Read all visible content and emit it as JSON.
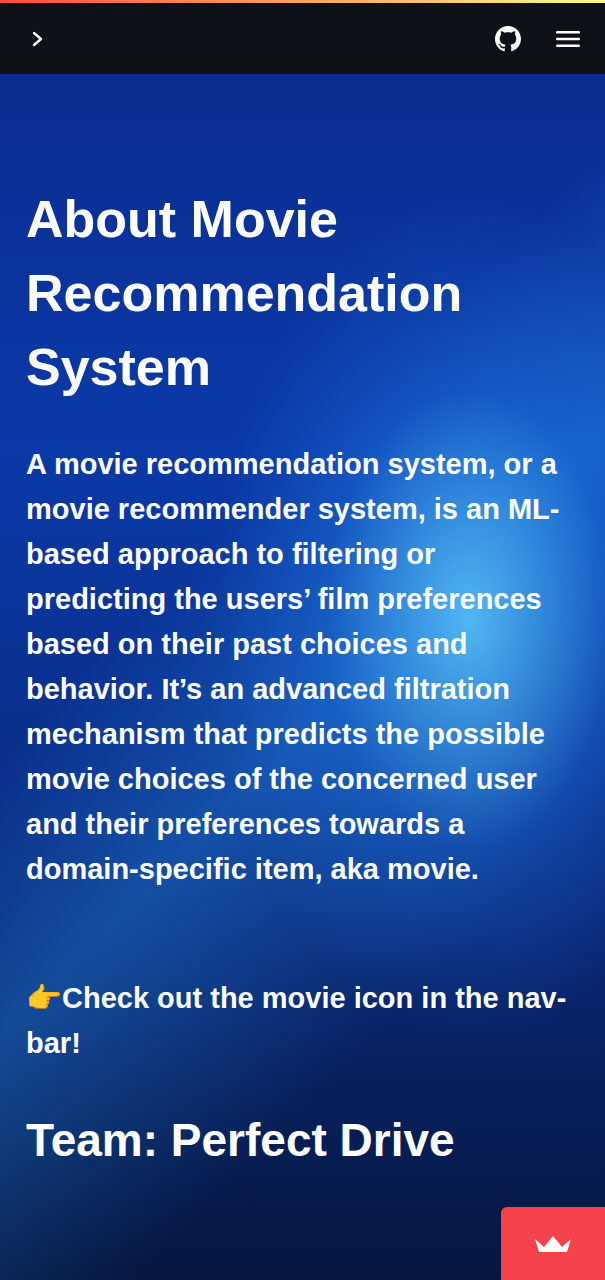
{
  "page": {
    "title": "About Movie Recommendation System",
    "description": "A movie recommendation system, or a movie recommender system, is an ML-based approach to filtering or predicting the users’ film preferences based on their past choices and behavior. It’s an advanced filtration mechanism that predicts the possible movie choices of the concerned user and their preferences towards a domain-specific item, aka movie.",
    "hint": {
      "emoji": "👉",
      "text": "Check out the movie icon in the nav-bar!"
    },
    "team": "Team: Perfect Drive"
  }
}
